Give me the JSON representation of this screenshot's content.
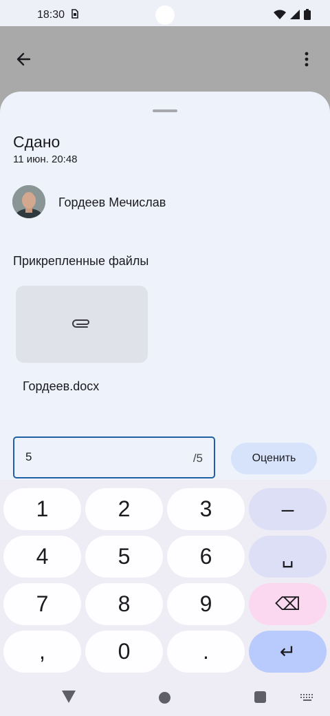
{
  "status_bar": {
    "time": "18:30",
    "sim_icon": "sim-card-icon",
    "icons": [
      "wifi-icon",
      "signal-icon",
      "battery-icon"
    ]
  },
  "app_bar": {
    "back_icon": "arrow-back-icon",
    "more_icon": "more-vert-icon"
  },
  "submission": {
    "status": "Сдано",
    "date": "11 июн. 20:48",
    "student_name": "Гордеев Мечислав",
    "files_heading": "Прикрепленные файлы",
    "files": [
      {
        "name": "Гордеев.docx",
        "icon": "attachment-icon"
      }
    ]
  },
  "grading": {
    "value": "5",
    "suffix": "/5",
    "button_label": "Оценить",
    "accent": "#1e5fa6"
  },
  "keyboard": {
    "rows": [
      [
        "1",
        "2",
        "3",
        "–"
      ],
      [
        "4",
        "5",
        "6",
        "␣"
      ],
      [
        "7",
        "8",
        "9",
        "⌫"
      ],
      [
        ",",
        "0",
        ".",
        "↵"
      ]
    ]
  },
  "colors": {
    "sheet_bg": "#eef2fb",
    "scrim": "#a9a9a9",
    "button_bg": "#d6e3fb"
  }
}
